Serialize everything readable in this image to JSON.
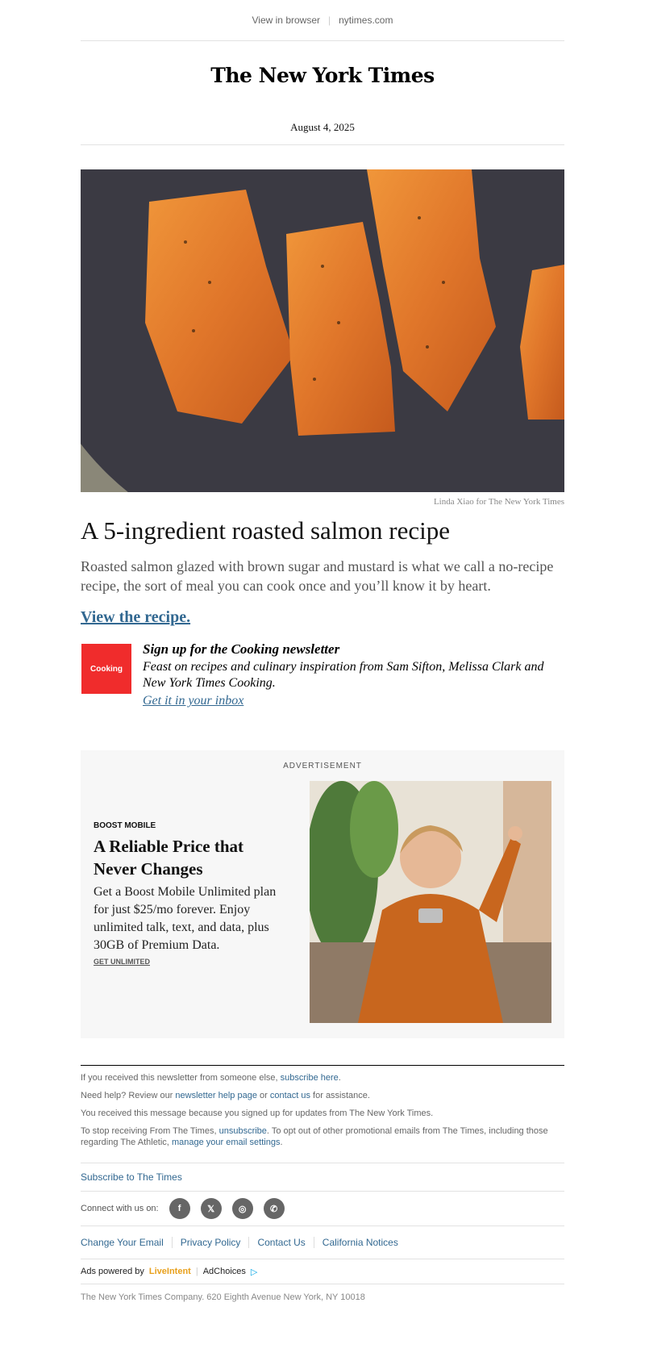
{
  "topbar": {
    "view_in_browser": "View in browser",
    "separator": "|",
    "site": "nytimes.com"
  },
  "masthead": {
    "logo": "The New York Times",
    "date": "August 4, 2025"
  },
  "hero": {
    "image_icon": "salmon-photo",
    "credit": "Linda Xiao for The New York Times"
  },
  "article": {
    "headline": "A 5-ingredient roasted salmon recipe",
    "dek": "Roasted salmon glazed with brown sugar and mustard is what we call a no-recipe recipe, the sort of meal you can cook once and you’ll know it by heart.",
    "cta": "View the recipe."
  },
  "promo": {
    "logo_text": "Cooking",
    "title": "Sign up for the Cooking newsletter",
    "description": "Feast on recipes and culinary inspiration from Sam Sifton, Melissa Clark and New York Times Cooking.",
    "link": "Get it in your inbox"
  },
  "ad": {
    "label": "ADVERTISEMENT",
    "brand": "BOOST MOBILE",
    "headline": "A Reliable Price that Never Changes",
    "body": "Get a Boost Mobile Unlimited plan for just $25/mo forever. Enjoy unlimited talk, text, and data, plus 30GB of Premium Data.",
    "link": "GET UNLIMITED"
  },
  "footer": {
    "p1_text": "If you received this newsletter from someone else,",
    "p1_link": "subscribe here",
    "p2_text_a": "Need help? Review our",
    "p2_link_a": "newsletter help page",
    "p2_text_b": "or",
    "p2_link_b": "contact us",
    "p2_text_c": "for assistance.",
    "p3_text": "You received this message because you signed up for updates from The New York Times.",
    "p4_text_a": "To stop receiving From The Times,",
    "p4_link_a": "unsubscribe",
    "p4_text_b": ". To opt out of other promotional emails from The Times, including those regarding The Athletic,",
    "p4_link_b": "manage your email settings",
    "subscribe": "Subscribe to The Times",
    "connect_label": "Connect with us on:",
    "social": [
      "facebook-icon",
      "x-icon",
      "instagram-icon",
      "whatsapp-icon"
    ],
    "links": [
      "Change Your Email",
      "Privacy Policy",
      "Contact Us",
      "California Notices"
    ],
    "ads_powered": "Ads powered by",
    "liveintent": "LiveIntent",
    "adchoices": "AdChoices",
    "address": "The New York Times Company. 620 Eighth Avenue New York, NY 10018"
  },
  "colors": {
    "link": "#326891",
    "cooking_red": "#f02c2c",
    "ad_bg": "#f7f7f7"
  }
}
